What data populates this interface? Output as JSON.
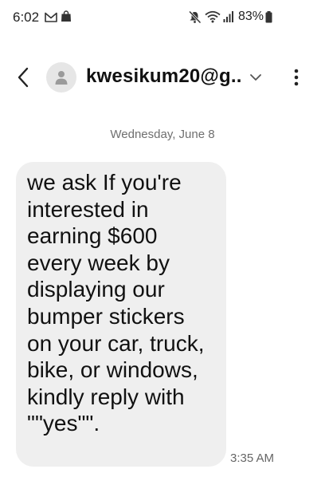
{
  "status_bar": {
    "time": "6:02",
    "battery_percent": "83%",
    "icons": [
      "mail-icon",
      "shopping-bag-icon",
      "mute-icon",
      "wifi-icon",
      "signal-icon",
      "battery-icon"
    ]
  },
  "header": {
    "contact_name": "kwesikum20@g...",
    "icons": [
      "back-arrow-icon",
      "person-icon",
      "chevron-down-icon",
      "more-vertical-icon"
    ]
  },
  "conversation": {
    "date": "Wednesday, June 8",
    "messages": [
      {
        "text": "we ask If you're\ninterested in\nearning $600\nevery week by\ndisplaying our\nbumper stickers\non your car, truck,\nbike, or windows,\nkindly reply with\n\"\"yes\"\".",
        "time": "3:35 AM"
      }
    ]
  },
  "colors": {
    "background": "#ffffff",
    "bubble": "#efefef",
    "avatar": "#e6e6e6",
    "secondary_text": "#6f6f6f"
  }
}
